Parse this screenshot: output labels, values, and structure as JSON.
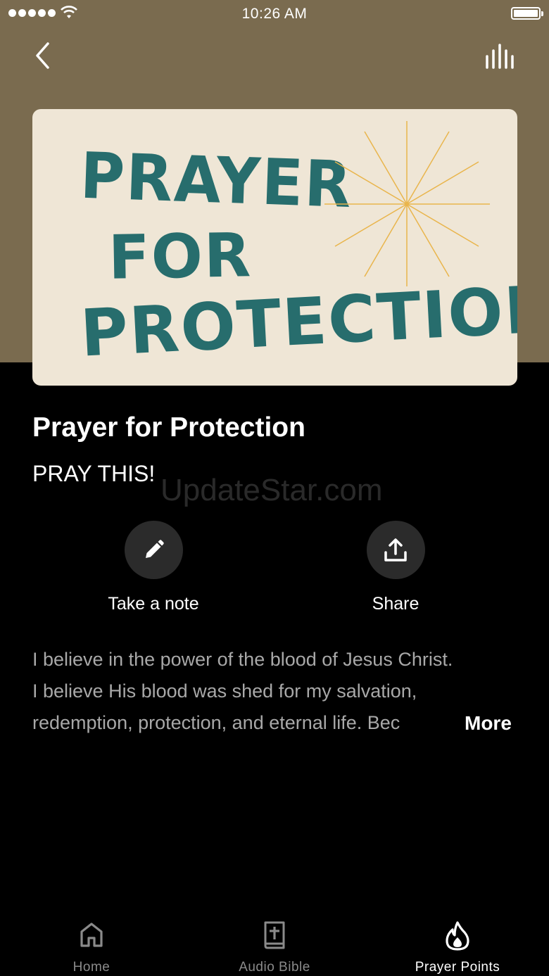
{
  "status_bar": {
    "time": "10:26 AM"
  },
  "header": {
    "back_icon": "chevron-left-icon",
    "equalizer_icon": "equalizer-icon",
    "background_color": "#7a6b4f"
  },
  "artwork": {
    "line1": "PRAYER",
    "line2": "FOR",
    "line3": "PROTECTION",
    "text_color": "#276d6d",
    "background_color": "#efe6d6",
    "accent_color": "#e9b54c"
  },
  "episode": {
    "title": "Prayer for Protection",
    "subtitle": "PRAY THIS!"
  },
  "watermark": "UpdateStar.com",
  "actions": {
    "note_label": "Take a note",
    "note_icon": "pencil-icon",
    "share_label": "Share",
    "share_icon": "share-icon"
  },
  "description": {
    "line1": "I believe in the power of the blood of Jesus Christ.",
    "line2": "I believe His blood was shed for my salvation,",
    "line3": "redemption, protection, and eternal life. Bec",
    "more_label": "More"
  },
  "tabbar": {
    "tabs": [
      {
        "label": "Home",
        "icon": "home-icon",
        "active": false
      },
      {
        "label": "Audio Bible",
        "icon": "bible-icon",
        "active": false
      },
      {
        "label": "Prayer Points",
        "icon": "flame-icon",
        "active": true
      }
    ]
  }
}
